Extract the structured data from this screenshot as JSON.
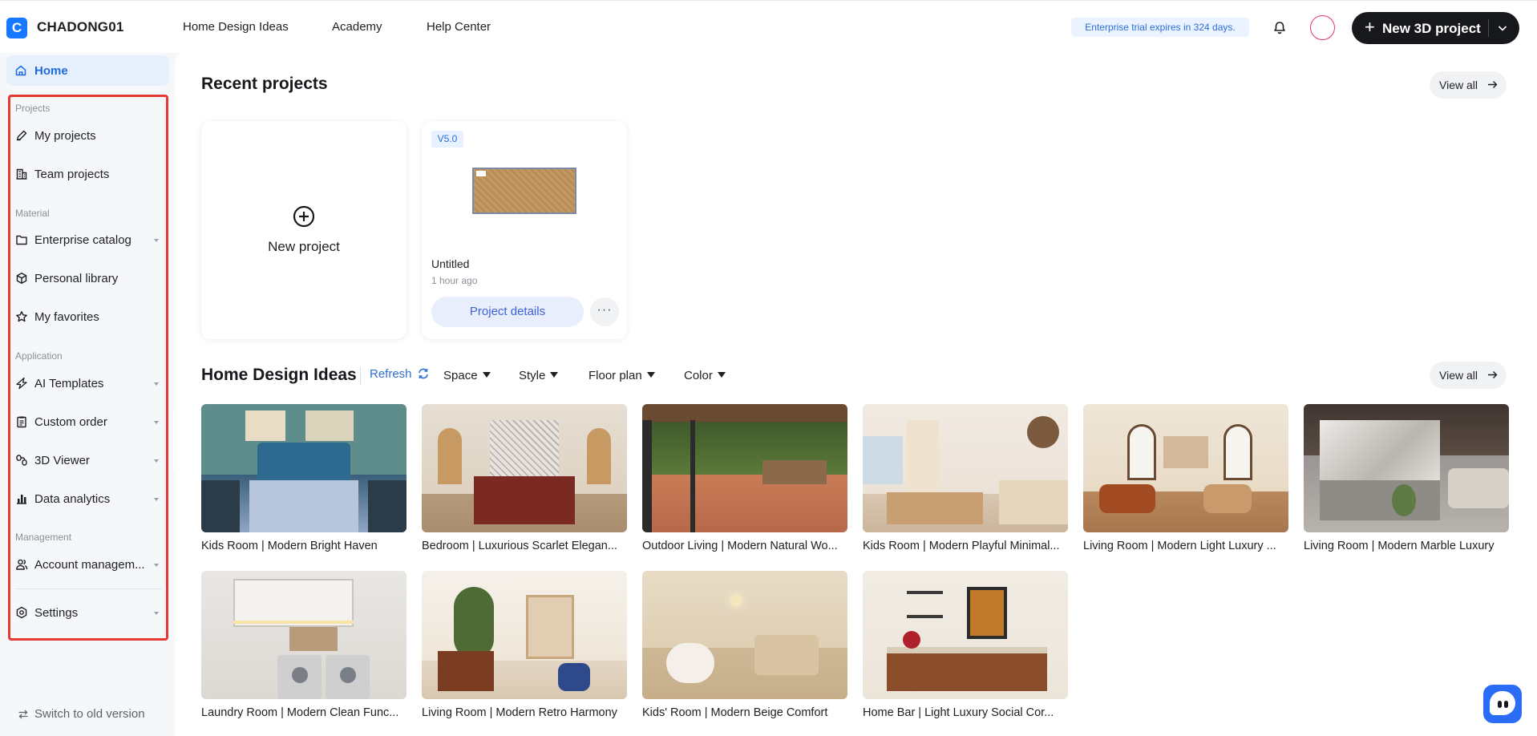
{
  "header": {
    "logo_letter": "C",
    "brand": "CHADONG01",
    "nav": [
      "Home Design Ideas",
      "Academy",
      "Help Center"
    ],
    "trial_text": "Enterprise trial expires in 324 days.",
    "new_project_label": "New 3D project"
  },
  "sidebar": {
    "home_label": "Home",
    "sections": {
      "projects": "Projects",
      "material": "Material",
      "application": "Application",
      "management": "Management"
    },
    "items": [
      {
        "label": "My projects",
        "icon": "edit-pencil-icon",
        "has_dropdown": false
      },
      {
        "label": "Team projects",
        "icon": "building-icon",
        "has_dropdown": false
      },
      {
        "label": "Enterprise catalog",
        "icon": "folder-icon",
        "has_dropdown": true
      },
      {
        "label": "Personal library",
        "icon": "cube-icon",
        "has_dropdown": false
      },
      {
        "label": "My favorites",
        "icon": "star-icon",
        "has_dropdown": false
      },
      {
        "label": "AI Templates",
        "icon": "lightning-icon",
        "has_dropdown": true
      },
      {
        "label": "Custom order",
        "icon": "clipboard-icon",
        "has_dropdown": true
      },
      {
        "label": "3D Viewer",
        "icon": "viewer-icon",
        "has_dropdown": true
      },
      {
        "label": "Data analytics",
        "icon": "bar-chart-icon",
        "has_dropdown": true
      },
      {
        "label": "Account managem...",
        "icon": "user-group-icon",
        "has_dropdown": true
      },
      {
        "label": "Settings",
        "icon": "gear-icon",
        "has_dropdown": true
      }
    ],
    "switch_label": "Switch to old version"
  },
  "recent": {
    "title": "Recent projects",
    "view_all": "View all",
    "new_project": "New project",
    "project": {
      "version": "V5.0",
      "name": "Untitled",
      "time": "1 hour ago",
      "details_label": "Project details",
      "more_label": "···"
    }
  },
  "ideas": {
    "title": "Home Design Ideas",
    "refresh": "Refresh",
    "filters": [
      "Space",
      "Style",
      "Floor plan",
      "Color"
    ],
    "view_all": "View all",
    "items": [
      "Kids Room | Modern Bright Haven",
      "Bedroom | Luxurious Scarlet Elegan...",
      "Outdoor Living | Modern Natural Wo...",
      "Kids Room | Modern Playful Minimal...",
      "Living Room | Modern Light Luxury ...",
      "Living Room | Modern Marble Luxury",
      "Laundry Room | Modern Clean Func...",
      "Living Room | Modern Retro Harmony",
      "Kids' Room | Modern Beige Comfort",
      "Home Bar | Light Luxury Social Cor..."
    ]
  },
  "colors": {
    "accent": "#1677ff",
    "highlight_box": "#e53935",
    "link": "#2c6fd6"
  }
}
